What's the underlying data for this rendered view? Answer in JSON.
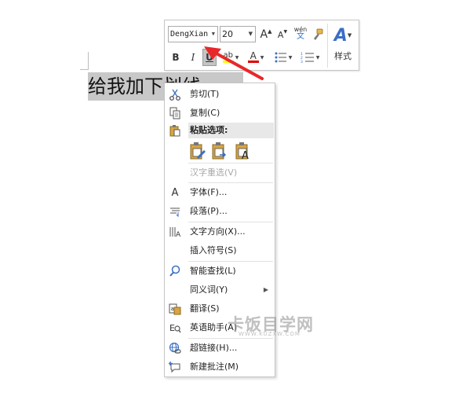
{
  "document": {
    "selected_text": "给我加下划线"
  },
  "mini_toolbar": {
    "font_name": "DengXian",
    "font_size": "20",
    "grow_font_label": "A",
    "shrink_font_label": "A",
    "pinyin_top": "wén",
    "pinyin_bottom": "文",
    "styles_icon": "A",
    "styles_label": "样式",
    "bold_label": "B",
    "italic_label": "I",
    "underline_label": "U",
    "highlight_label": "ab",
    "font_color_label": "A",
    "accent_blue": "#3a6fc4",
    "highlight_color": "#ffff00",
    "font_color": "#e00000"
  },
  "annotation": {
    "arrow_color": "#e8272a"
  },
  "context_menu": {
    "items": [
      {
        "icon": "cut-icon",
        "label": "剪切(T)"
      },
      {
        "icon": "copy-icon",
        "label": "复制(C)"
      },
      {
        "icon": "paste-icon",
        "label": "粘贴选项:"
      },
      {
        "icon": "",
        "label": "汉字重选(V)",
        "disabled": true
      },
      {
        "icon": "font-icon",
        "label": "字体(F)..."
      },
      {
        "icon": "paragraph-icon",
        "label": "段落(P)..."
      },
      {
        "icon": "text-direction-icon",
        "label": "文字方向(X)..."
      },
      {
        "icon": "",
        "label": "插入符号(S)"
      },
      {
        "icon": "smart-lookup-icon",
        "label": "智能查找(L)"
      },
      {
        "icon": "",
        "label": "同义词(Y)"
      },
      {
        "icon": "translate-icon",
        "label": "翻译(S)"
      },
      {
        "icon": "english-assistant-icon",
        "label": "英语助手(A)"
      },
      {
        "icon": "hyperlink-icon",
        "label": "超链接(H)..."
      },
      {
        "icon": "new-comment-icon",
        "label": "新建批注(M)"
      }
    ]
  },
  "watermark": {
    "main": "卡饭目学网",
    "sub": "WWW.KUZXW.COM"
  }
}
